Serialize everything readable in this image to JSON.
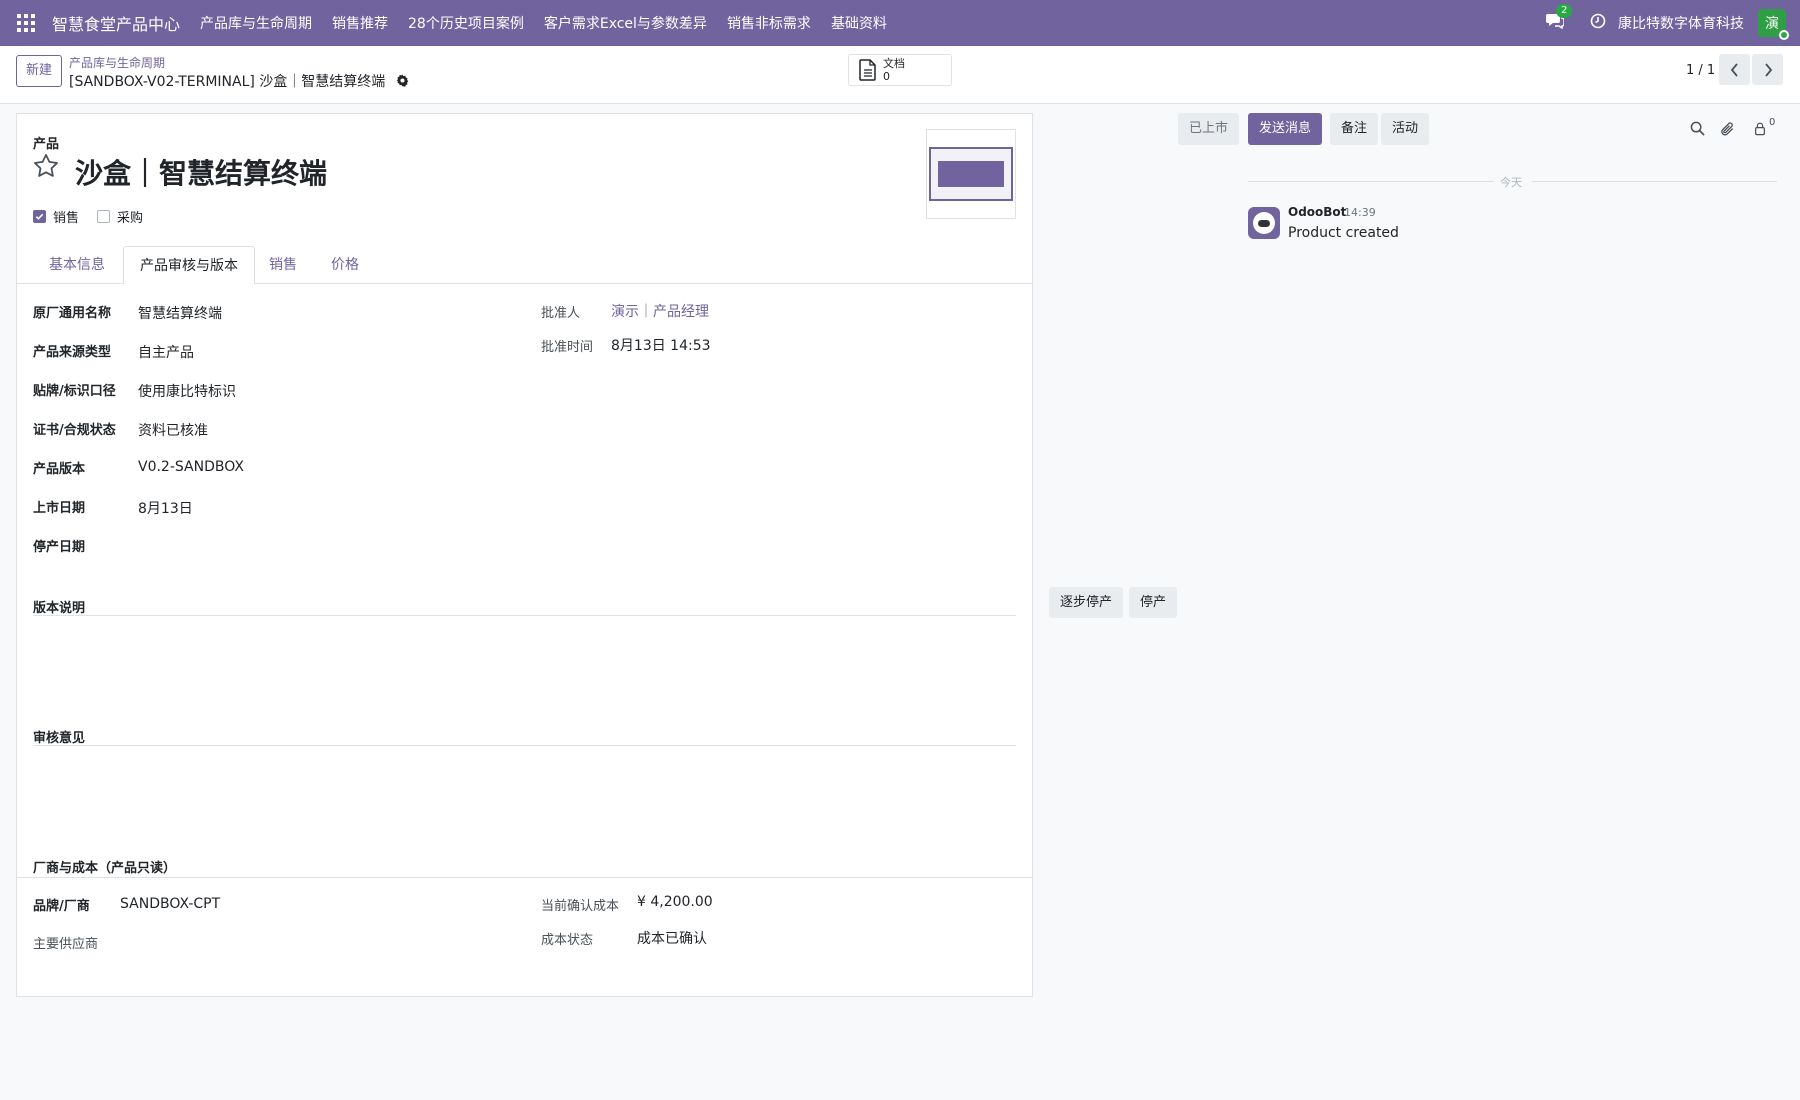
{
  "navbar": {
    "app_name": "智慧食堂产品中心",
    "menus": [
      "产品库与生命周期",
      "销售推荐",
      "28个历史项目案例",
      "客户需求Excel与参数差异",
      "销售非标需求",
      "基础资料"
    ],
    "messages_count": "2",
    "company": "康比特数字体育科技",
    "avatar_initial": "演"
  },
  "control": {
    "new_label": "新建",
    "breadcrumb_parent": "产品库与生命周期",
    "record_title": "[SANDBOX-V02-TERMINAL] 沙盒｜智慧结算终端",
    "docs_label": "文档",
    "docs_count": "0",
    "pager": "1 / 1"
  },
  "form": {
    "product_label": "产品",
    "product_name": "沙盒｜智慧结算终端",
    "sale_label": "销售",
    "sale_checked": true,
    "purchase_label": "采购",
    "purchase_checked": false,
    "tabs": [
      "基本信息",
      "产品审核与版本",
      "销售",
      "价格"
    ],
    "active_tab": "产品审核与版本",
    "left_fields": [
      {
        "label": "原厂通用名称",
        "value": "智慧结算终端"
      },
      {
        "label": "产品来源类型",
        "value": "自主产品"
      },
      {
        "label": "贴牌/标识口径",
        "value": "使用康比特标识"
      },
      {
        "label": "证书/合规状态",
        "value": "资料已核准"
      },
      {
        "label": "产品版本",
        "value": "V0.2-SANDBOX"
      },
      {
        "label": "上市日期",
        "value": "8月13日"
      },
      {
        "label": "停产日期",
        "value": ""
      }
    ],
    "approver_label": "批准人",
    "approver_value": "演示｜产品经理",
    "approve_time_label": "批准时间",
    "approve_time_value": "8月13日 14:53",
    "version_notes_title": "版本说明",
    "review_comments_title": "审核意见",
    "vendor_section_title": "厂商与成本（产品只读）",
    "brand_label": "品牌/厂商",
    "brand_value": "SANDBOX-CPT",
    "main_supplier_label": "主要供应商",
    "main_supplier_value": "",
    "confirmed_cost_label": "当前确认成本",
    "confirmed_cost_value": "¥ 4,200.00",
    "cost_status_label": "成本状态",
    "cost_status_value": "成本已确认"
  },
  "statusbar": {
    "gradual_discontinue": "逐步停产",
    "discontinue": "停产",
    "on_market": "已上市"
  },
  "chatter": {
    "send_message": "发送消息",
    "log_note": "备注",
    "activity": "活动",
    "followers_count": "0",
    "date_separator": "今天",
    "messages": [
      {
        "author": "OdooBot",
        "time": "14:39",
        "body": "Product created"
      }
    ]
  },
  "colors": {
    "brand": "#71639e",
    "status_green": "#28a745"
  }
}
